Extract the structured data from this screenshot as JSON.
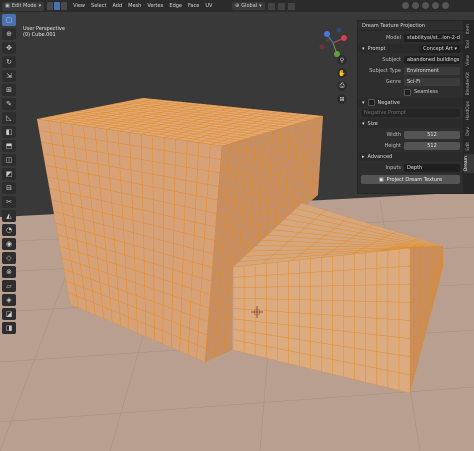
{
  "header": {
    "mode_label": "Edit Mode",
    "menu": [
      "View",
      "Select",
      "Add",
      "Mesh",
      "Vertex",
      "Edge",
      "Face",
      "UV"
    ],
    "transform_orientation": "Global"
  },
  "viewport": {
    "perspective_label": "User Perspective",
    "object_label": "(0) Cube.001"
  },
  "panel": {
    "title": "Dream Texture Projection",
    "model_label": "Model",
    "model_value": "stabilityai/st...ion-2-depth",
    "prompt_section": "Prompt",
    "prompt_preset": "Concept Art",
    "subject_label": "Subject",
    "subject_value": "abandoned buildings",
    "subject_type_label": "Subject Type",
    "subject_type_value": "Environment",
    "genre_label": "Genre",
    "genre_value": "Sci-Fi",
    "seamless_label": "Seamless",
    "negative_section": "Negative",
    "negative_placeholder": "Negative Prompt",
    "size_section": "Size",
    "width_label": "Width",
    "width_value": "512",
    "height_label": "Height",
    "height_value": "512",
    "advanced_section": "Advanced",
    "inputs_label": "Inputs",
    "inputs_value": "Depth",
    "project_button": "Project Dream Texture"
  },
  "side_tabs": [
    "Item",
    "Tool",
    "View",
    "BlenderKit",
    "HardOps",
    "Dev",
    "Edit",
    "Dream"
  ],
  "colors": {
    "accent": "#4772b3",
    "cube_face_top": "#e0a879",
    "cube_face_left": "#d8a278",
    "cube_face_right": "#c78e62",
    "floor": "#b89f90",
    "grid_line": "#e38a1a"
  }
}
